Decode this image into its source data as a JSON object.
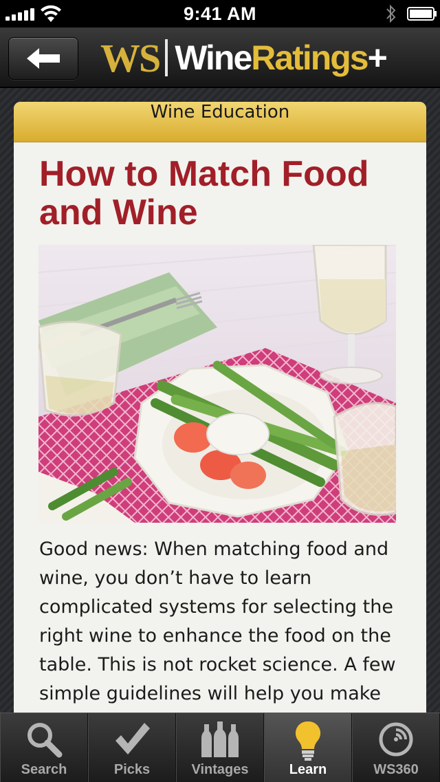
{
  "status_bar": {
    "time": "9:41 AM"
  },
  "nav_bar": {
    "logo_ws": "WS",
    "logo_wine": "Wine",
    "logo_ratings": "Ratings",
    "logo_plus": "+"
  },
  "card": {
    "section_title": "Wine Education",
    "article_title": "How to Match Food and Wine",
    "body_text": "Good news: When matching food and wine, you don’t have to learn complicated systems for selecting the right wine to enhance the food on the table. This is not rocket science. A few simple guidelines will help you make"
  },
  "tab_bar": {
    "tabs": [
      {
        "label": "Search",
        "icon": "search-icon"
      },
      {
        "label": "Picks",
        "icon": "checkmark-icon"
      },
      {
        "label": "Vintages",
        "icon": "bottles-icon"
      },
      {
        "label": "Learn",
        "icon": "lightbulb-icon"
      },
      {
        "label": "WS360",
        "icon": "ws360-icon"
      }
    ],
    "active_index": 3
  },
  "colors": {
    "brand_gold": "#d6b13c",
    "title_red": "#a11f28",
    "header_gold": "#e6c24e"
  }
}
